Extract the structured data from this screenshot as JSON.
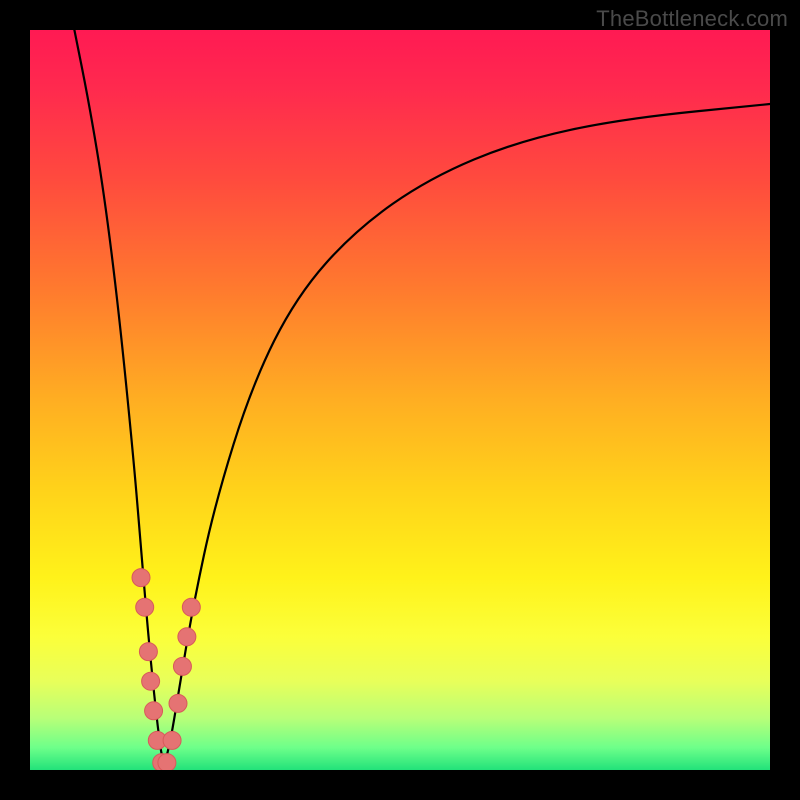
{
  "watermark": "TheBottleneck.com",
  "gradient": {
    "stops": [
      {
        "offset": 0.0,
        "color": "#ff1a53"
      },
      {
        "offset": 0.08,
        "color": "#ff2a4e"
      },
      {
        "offset": 0.2,
        "color": "#ff4a3e"
      },
      {
        "offset": 0.35,
        "color": "#ff7a2e"
      },
      {
        "offset": 0.5,
        "color": "#ffae22"
      },
      {
        "offset": 0.62,
        "color": "#ffd21a"
      },
      {
        "offset": 0.74,
        "color": "#fff21a"
      },
      {
        "offset": 0.82,
        "color": "#fbff3a"
      },
      {
        "offset": 0.88,
        "color": "#e8ff5a"
      },
      {
        "offset": 0.93,
        "color": "#b8ff78"
      },
      {
        "offset": 0.97,
        "color": "#6dff8a"
      },
      {
        "offset": 1.0,
        "color": "#22e27a"
      }
    ]
  },
  "chart_data": {
    "type": "line",
    "title": "",
    "xlabel": "",
    "ylabel": "",
    "xlim": [
      0,
      100
    ],
    "ylim": [
      0,
      100
    ],
    "x_minimum": 18,
    "curve": [
      {
        "x": 6,
        "y": 100
      },
      {
        "x": 8,
        "y": 90
      },
      {
        "x": 10,
        "y": 78
      },
      {
        "x": 12,
        "y": 62
      },
      {
        "x": 14,
        "y": 42
      },
      {
        "x": 15,
        "y": 30
      },
      {
        "x": 16,
        "y": 18
      },
      {
        "x": 17,
        "y": 8
      },
      {
        "x": 18,
        "y": 0
      },
      {
        "x": 19,
        "y": 4
      },
      {
        "x": 20,
        "y": 10
      },
      {
        "x": 22,
        "y": 22
      },
      {
        "x": 25,
        "y": 36
      },
      {
        "x": 30,
        "y": 52
      },
      {
        "x": 36,
        "y": 64
      },
      {
        "x": 44,
        "y": 73
      },
      {
        "x": 54,
        "y": 80
      },
      {
        "x": 66,
        "y": 85
      },
      {
        "x": 80,
        "y": 88
      },
      {
        "x": 100,
        "y": 90
      }
    ],
    "dots_threshold_y": 22,
    "dots": [
      {
        "x": 15.0,
        "y": 26
      },
      {
        "x": 15.5,
        "y": 22
      },
      {
        "x": 16.0,
        "y": 16
      },
      {
        "x": 16.3,
        "y": 12
      },
      {
        "x": 16.7,
        "y": 8
      },
      {
        "x": 17.2,
        "y": 4
      },
      {
        "x": 17.8,
        "y": 1
      },
      {
        "x": 18.5,
        "y": 1
      },
      {
        "x": 19.2,
        "y": 4
      },
      {
        "x": 20.0,
        "y": 9
      },
      {
        "x": 20.6,
        "y": 14
      },
      {
        "x": 21.2,
        "y": 18
      },
      {
        "x": 21.8,
        "y": 22
      }
    ],
    "dot_style": {
      "r": 9,
      "fill": "#e57373",
      "stroke": "#d85a5a",
      "stroke_width": 1
    },
    "curve_style": {
      "stroke": "#000000",
      "stroke_width": 2.2
    }
  }
}
